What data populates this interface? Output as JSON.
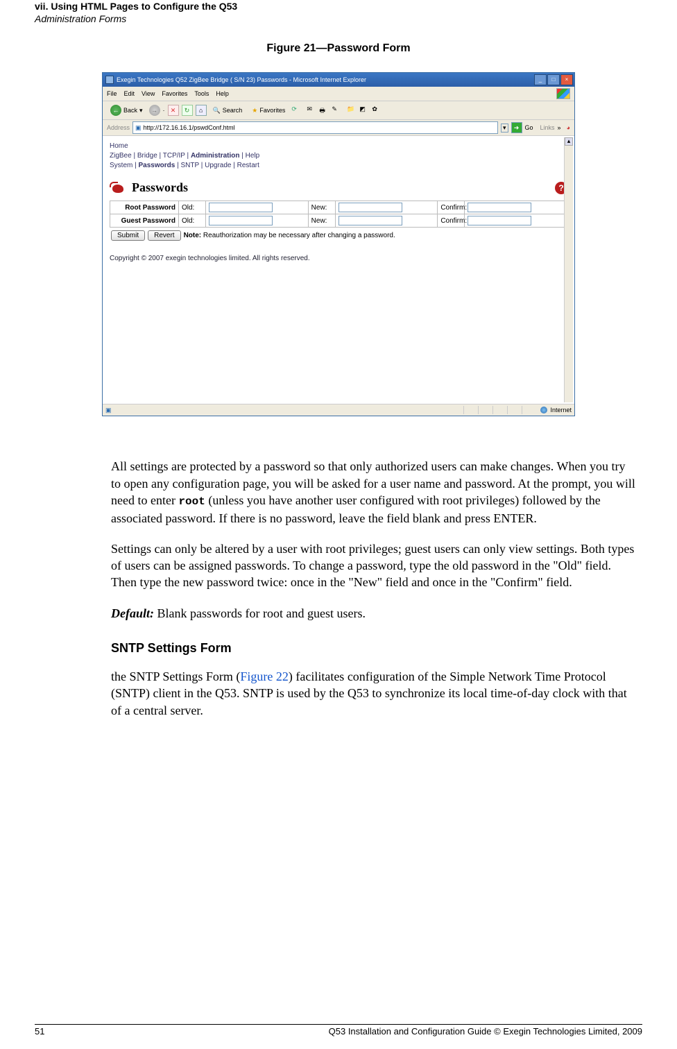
{
  "header": {
    "line1": "vii. Using HTML Pages to Configure the Q53",
    "line2": "Administration Forms"
  },
  "figure": {
    "caption": "Figure 21—Password Form"
  },
  "browser": {
    "title": "Exegin Technologies Q52 ZigBee Bridge ( S/N 23) Passwords - Microsoft Internet Explorer",
    "menu": {
      "file": "File",
      "edit": "Edit",
      "view": "View",
      "favorites": "Favorites",
      "tools": "Tools",
      "help": "Help"
    },
    "toolbar": {
      "back": "Back",
      "search": "Search",
      "favorites": "Favorites"
    },
    "address_label": "Address",
    "url": "http://172.16.16.1/pswdConf.html",
    "go": "Go",
    "links": "Links",
    "nav": {
      "home": "Home",
      "row1_a": "ZigBee",
      "row1_b": "Bridge",
      "row1_c": "TCP/IP",
      "row1_d": "Administration",
      "row1_e": "Help",
      "row2_a": "System",
      "row2_b": "Passwords",
      "row2_c": "SNTP",
      "row2_d": "Upgrade",
      "row2_e": "Restart"
    },
    "pw_heading": "Passwords",
    "help_q": "?",
    "rows": {
      "root": "Root Password",
      "guest": "Guest Password",
      "old": "Old:",
      "new": "New:",
      "confirm": "Confirm:"
    },
    "submit": "Submit",
    "revert": "Revert",
    "note_label": "Note:",
    "note_text": " Reauthorization may be necessary after changing a password.",
    "copyright": "Copyright © 2007 exegin technologies limited. All rights reserved.",
    "status_zone": "Internet"
  },
  "text": {
    "p1a": "All settings are protected by a password so that only authorized users can make changes. When you try to open any configuration page, you will be asked for a user name and password. At the prompt, you will need to enter ",
    "p1_root": "root",
    "p1b": " (unless you have another user configured with root privileges) followed by the associated password. If there is no password, leave the field blank and press ENTER.",
    "p2": "Settings can only be altered by a user with root privileges; guest users can only view settings. Both types of users can be assigned passwords. To change a password, type the old password in the \"Old\" field. Then type the new password twice: once in the \"New\" field and once in the \"Confirm\" field.",
    "p3_label": "Default:",
    "p3_text": " Blank passwords for root and guest users.",
    "subhead": "SNTP Settings Form",
    "p4a": "the SNTP Settings Form (",
    "p4_ref": "Figure 22",
    "p4b": ") facilitates configuration of the Simple Network Time Protocol (SNTP) client in the Q53. SNTP is used by the Q53 to synchronize its local time-of-day clock with that of a central server."
  },
  "footer": {
    "page": "51",
    "right": "Q53 Installation and Configuration Guide  © Exegin Technologies Limited, 2009"
  }
}
